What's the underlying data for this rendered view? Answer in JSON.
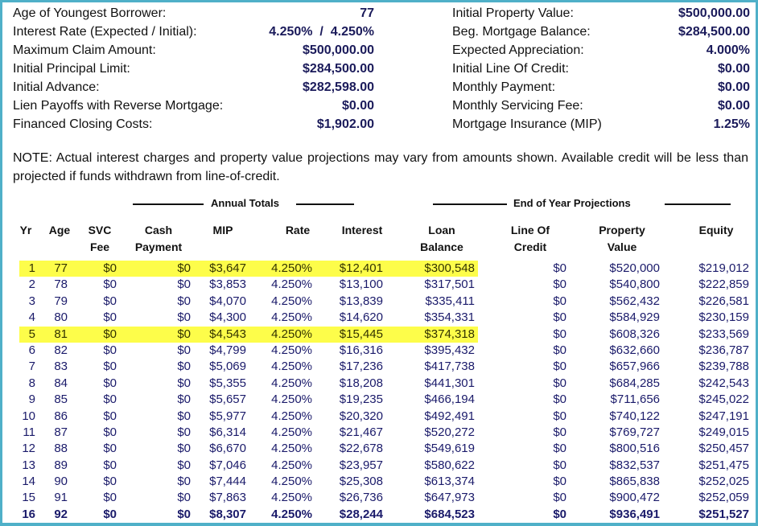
{
  "summary_left": [
    {
      "label": "Age of Youngest Borrower:",
      "value": "77"
    },
    {
      "label": "Interest Rate (Expected / Initial):",
      "value": "4.250%  /  4.250%"
    },
    {
      "label": "Maximum Claim Amount:",
      "value": "$500,000.00"
    },
    {
      "label": "Initial Principal Limit:",
      "value": "$284,500.00"
    },
    {
      "label": "Initial Advance:",
      "value": "$282,598.00"
    },
    {
      "label": "Lien Payoffs with Reverse Mortgage:",
      "value": "$0.00"
    },
    {
      "label": "Financed Closing Costs:",
      "value": "$1,902.00"
    }
  ],
  "summary_right": [
    {
      "label": "Initial Property Value:",
      "value": "$500,000.00"
    },
    {
      "label": "Beg. Mortgage Balance:",
      "value": "$284,500.00"
    },
    {
      "label": "Expected Appreciation:",
      "value": "4.000%"
    },
    {
      "label": "Initial Line Of Credit:",
      "value": "$0.00"
    },
    {
      "label": "Monthly Payment:",
      "value": "$0.00"
    },
    {
      "label": "Monthly Servicing Fee:",
      "value": "$0.00"
    },
    {
      "label": "Mortgage Insurance (MIP)",
      "value": "1.25%"
    }
  ],
  "note": "NOTE: Actual interest charges and property value projections may vary from amounts shown. Available credit will be less than projected if funds withdrawn from line-of-credit.",
  "groups": {
    "annual_totals": "Annual Totals",
    "end_of_year": "End of Year Projections"
  },
  "columns": [
    {
      "key": "yr",
      "line1": "Yr",
      "line2": ""
    },
    {
      "key": "age",
      "line1": "Age",
      "line2": ""
    },
    {
      "key": "svc_fee",
      "line1": "SVC",
      "line2": "Fee"
    },
    {
      "key": "cash_payment",
      "line1": "Cash",
      "line2": "Payment"
    },
    {
      "key": "mip",
      "line1": "MIP",
      "line2": ""
    },
    {
      "key": "rate",
      "line1": "Rate",
      "line2": ""
    },
    {
      "key": "interest",
      "line1": "Interest",
      "line2": ""
    },
    {
      "key": "loan_balance",
      "line1": "Loan",
      "line2": "Balance"
    },
    {
      "key": "line_of_credit",
      "line1": "Line Of",
      "line2": "Credit"
    },
    {
      "key": "property_value",
      "line1": "Property",
      "line2": "Value"
    },
    {
      "key": "equity",
      "line1": "Equity",
      "line2": ""
    }
  ],
  "highlight_color": "#fdfd4a",
  "rows": [
    {
      "yr": "1",
      "age": "77",
      "svc_fee": "$0",
      "cash_payment": "$0",
      "mip": "$3,647",
      "rate": "4.250%",
      "interest": "$12,401",
      "loan_balance": "$300,548",
      "line_of_credit": "$0",
      "property_value": "$520,000",
      "equity": "$219,012",
      "highlighted": true
    },
    {
      "yr": "2",
      "age": "78",
      "svc_fee": "$0",
      "cash_payment": "$0",
      "mip": "$3,853",
      "rate": "4.250%",
      "interest": "$13,100",
      "loan_balance": "$317,501",
      "line_of_credit": "$0",
      "property_value": "$540,800",
      "equity": "$222,859"
    },
    {
      "yr": "3",
      "age": "79",
      "svc_fee": "$0",
      "cash_payment": "$0",
      "mip": "$4,070",
      "rate": "4.250%",
      "interest": "$13,839",
      "loan_balance": "$335,411",
      "line_of_credit": "$0",
      "property_value": "$562,432",
      "equity": "$226,581"
    },
    {
      "yr": "4",
      "age": "80",
      "svc_fee": "$0",
      "cash_payment": "$0",
      "mip": "$4,300",
      "rate": "4.250%",
      "interest": "$14,620",
      "loan_balance": "$354,331",
      "line_of_credit": "$0",
      "property_value": "$584,929",
      "equity": "$230,159"
    },
    {
      "yr": "5",
      "age": "81",
      "svc_fee": "$0",
      "cash_payment": "$0",
      "mip": "$4,543",
      "rate": "4.250%",
      "interest": "$15,445",
      "loan_balance": "$374,318",
      "line_of_credit": "$0",
      "property_value": "$608,326",
      "equity": "$233,569",
      "highlighted": true
    },
    {
      "yr": "6",
      "age": "82",
      "svc_fee": "$0",
      "cash_payment": "$0",
      "mip": "$4,799",
      "rate": "4.250%",
      "interest": "$16,316",
      "loan_balance": "$395,432",
      "line_of_credit": "$0",
      "property_value": "$632,660",
      "equity": "$236,787"
    },
    {
      "yr": "7",
      "age": "83",
      "svc_fee": "$0",
      "cash_payment": "$0",
      "mip": "$5,069",
      "rate": "4.250%",
      "interest": "$17,236",
      "loan_balance": "$417,738",
      "line_of_credit": "$0",
      "property_value": "$657,966",
      "equity": "$239,788"
    },
    {
      "yr": "8",
      "age": "84",
      "svc_fee": "$0",
      "cash_payment": "$0",
      "mip": "$5,355",
      "rate": "4.250%",
      "interest": "$18,208",
      "loan_balance": "$441,301",
      "line_of_credit": "$0",
      "property_value": "$684,285",
      "equity": "$242,543"
    },
    {
      "yr": "9",
      "age": "85",
      "svc_fee": "$0",
      "cash_payment": "$0",
      "mip": "$5,657",
      "rate": "4.250%",
      "interest": "$19,235",
      "loan_balance": "$466,194",
      "line_of_credit": "$0",
      "property_value": "$711,656",
      "equity": "$245,022"
    },
    {
      "yr": "10",
      "age": "86",
      "svc_fee": "$0",
      "cash_payment": "$0",
      "mip": "$5,977",
      "rate": "4.250%",
      "interest": "$20,320",
      "loan_balance": "$492,491",
      "line_of_credit": "$0",
      "property_value": "$740,122",
      "equity": "$247,191"
    },
    {
      "yr": "11",
      "age": "87",
      "svc_fee": "$0",
      "cash_payment": "$0",
      "mip": "$6,314",
      "rate": "4.250%",
      "interest": "$21,467",
      "loan_balance": "$520,272",
      "line_of_credit": "$0",
      "property_value": "$769,727",
      "equity": "$249,015"
    },
    {
      "yr": "12",
      "age": "88",
      "svc_fee": "$0",
      "cash_payment": "$0",
      "mip": "$6,670",
      "rate": "4.250%",
      "interest": "$22,678",
      "loan_balance": "$549,619",
      "line_of_credit": "$0",
      "property_value": "$800,516",
      "equity": "$250,457"
    },
    {
      "yr": "13",
      "age": "89",
      "svc_fee": "$0",
      "cash_payment": "$0",
      "mip": "$7,046",
      "rate": "4.250%",
      "interest": "$23,957",
      "loan_balance": "$580,622",
      "line_of_credit": "$0",
      "property_value": "$832,537",
      "equity": "$251,475"
    },
    {
      "yr": "14",
      "age": "90",
      "svc_fee": "$0",
      "cash_payment": "$0",
      "mip": "$7,444",
      "rate": "4.250%",
      "interest": "$25,308",
      "loan_balance": "$613,374",
      "line_of_credit": "$0",
      "property_value": "$865,838",
      "equity": "$252,025"
    },
    {
      "yr": "15",
      "age": "91",
      "svc_fee": "$0",
      "cash_payment": "$0",
      "mip": "$7,863",
      "rate": "4.250%",
      "interest": "$26,736",
      "loan_balance": "$647,973",
      "line_of_credit": "$0",
      "property_value": "$900,472",
      "equity": "$252,059"
    },
    {
      "yr": "16",
      "age": "92",
      "svc_fee": "$0",
      "cash_payment": "$0",
      "mip": "$8,307",
      "rate": "4.250%",
      "interest": "$28,244",
      "loan_balance": "$684,523",
      "line_of_credit": "$0",
      "property_value": "$936,491",
      "equity": "$251,527",
      "bold": true
    }
  ]
}
